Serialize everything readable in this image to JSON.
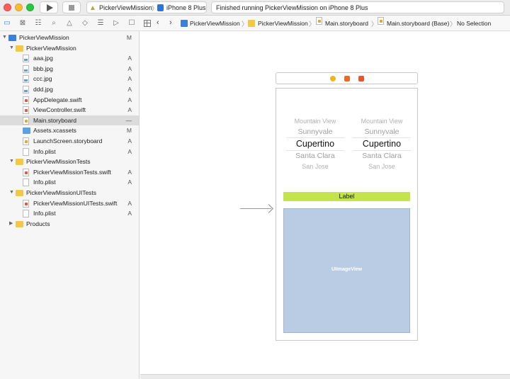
{
  "toolbar": {
    "scheme_name": "PickerViewMission",
    "scheme_separator": "〉",
    "device_name": "iPhone 8 Plus",
    "activity_text": "Finished running PickerViewMission on iPhone 8 Plus"
  },
  "navigator_tabs": [
    "folder-icon",
    "source-control-icon",
    "hierarchy-icon",
    "search-icon",
    "issue-icon",
    "test-icon",
    "debug-icon",
    "breakpoint-icon",
    "report-icon"
  ],
  "sidebar": {
    "rows": [
      {
        "label": "PickerViewMission",
        "status": "M",
        "disclosure": "▼",
        "icon": "project"
      },
      {
        "label": "PickerViewMission",
        "status": "",
        "disclosure": "▼",
        "icon": "folder"
      },
      {
        "label": "aaa.jpg",
        "status": "A",
        "disclosure": "",
        "icon": "image"
      },
      {
        "label": "bbb.jpg",
        "status": "A",
        "disclosure": "",
        "icon": "image"
      },
      {
        "label": "ccc.jpg",
        "status": "A",
        "disclosure": "",
        "icon": "image"
      },
      {
        "label": "ddd.jpg",
        "status": "A",
        "disclosure": "",
        "icon": "image"
      },
      {
        "label": "AppDelegate.swift",
        "status": "A",
        "disclosure": "",
        "icon": "swift"
      },
      {
        "label": "ViewController.swift",
        "status": "A",
        "disclosure": "",
        "icon": "swift"
      },
      {
        "label": "Main.storyboard",
        "status": "—",
        "disclosure": "",
        "icon": "storyboard",
        "selected": true
      },
      {
        "label": "Assets.xcassets",
        "status": "M",
        "disclosure": "",
        "icon": "assets"
      },
      {
        "label": "LaunchScreen.storyboard",
        "status": "A",
        "disclosure": "",
        "icon": "storyboard"
      },
      {
        "label": "Info.plist",
        "status": "A",
        "disclosure": "",
        "icon": "plist"
      },
      {
        "label": "PickerViewMissionTests",
        "status": "",
        "disclosure": "▼",
        "icon": "folder"
      },
      {
        "label": "PickerViewMissionTests.swift",
        "status": "A",
        "disclosure": "",
        "icon": "swift"
      },
      {
        "label": "Info.plist",
        "status": "A",
        "disclosure": "",
        "icon": "plist"
      },
      {
        "label": "PickerViewMissionUITests",
        "status": "",
        "disclosure": "▼",
        "icon": "folder"
      },
      {
        "label": "PickerViewMissionUITests.swift",
        "status": "A",
        "disclosure": "",
        "icon": "swift"
      },
      {
        "label": "Info.plist",
        "status": "A",
        "disclosure": "",
        "icon": "plist"
      },
      {
        "label": "Products",
        "status": "",
        "disclosure": "▶",
        "icon": "folder"
      }
    ]
  },
  "jumpbar": {
    "items": [
      "PickerViewMission",
      "PickerViewMission",
      "Main.storyboard",
      "Main.storyboard (Base)",
      "No Selection"
    ],
    "separator": "〉",
    "back": "‹",
    "forward": "›"
  },
  "canvas": {
    "picker_left": [
      "Mountain View",
      "Sunnyvale",
      "Cupertino",
      "Santa Clara",
      "San Jose"
    ],
    "picker_right": [
      "Mountain View",
      "Sunnyvale",
      "Cupertino",
      "Santa Clara",
      "San Jose"
    ],
    "label_text": "Label",
    "imageview_text": "UIImageView",
    "label_color": "#c3e54b",
    "imageview_color": "#b9cce4"
  }
}
